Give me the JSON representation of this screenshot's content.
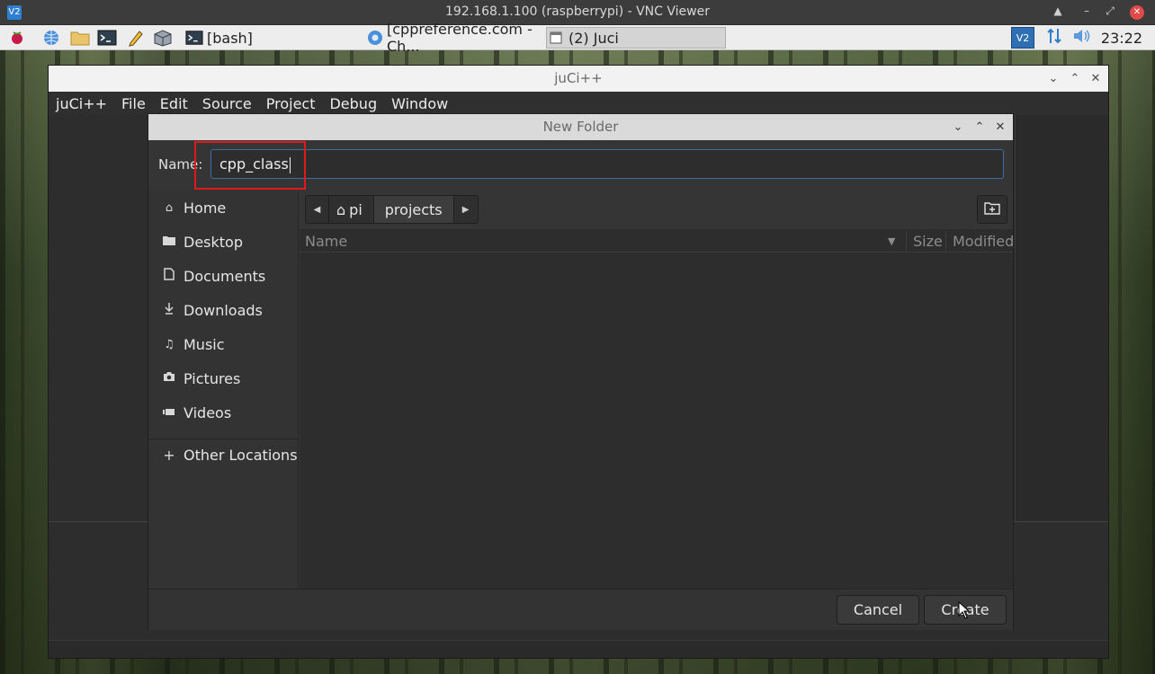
{
  "vnc": {
    "logo": "V2",
    "title": "192.168.1.100 (raspberrypi) - VNC Viewer",
    "controls": [
      "▲",
      "–",
      "⤢"
    ],
    "close": "✕"
  },
  "taskbar": {
    "launchers": [
      "raspberry-icon",
      "web-browser-icon",
      "file-manager-icon",
      "terminal-icon",
      "text-editor-icon",
      "package-icon"
    ],
    "tasks": [
      {
        "label": "[bash]",
        "icon": "terminal-icon"
      },
      {
        "label": "[cppreference.com - Ch...",
        "icon": "chromium-icon"
      },
      {
        "label": "(2) Juci",
        "icon": "window-icon"
      }
    ],
    "tray": [
      "vnc-icon",
      "network-icon",
      "volume-icon"
    ],
    "clock": "23:22"
  },
  "app": {
    "title": "juCi++",
    "menu": [
      "juCi++",
      "File",
      "Edit",
      "Source",
      "Project",
      "Debug",
      "Window"
    ]
  },
  "dialog": {
    "title": "New Folder",
    "name_label": "Name:",
    "name_value": "cpp_class",
    "places": [
      {
        "label": "Home",
        "icon": "home-icon"
      },
      {
        "label": "Desktop",
        "icon": "desktop-folder-icon"
      },
      {
        "label": "Documents",
        "icon": "document-icon"
      },
      {
        "label": "Downloads",
        "icon": "download-icon"
      },
      {
        "label": "Music",
        "icon": "music-icon"
      },
      {
        "label": "Pictures",
        "icon": "camera-icon"
      },
      {
        "label": "Videos",
        "icon": "video-icon"
      },
      {
        "label": "Other Locations",
        "icon": "plus-icon"
      }
    ],
    "path": [
      "pi",
      "projects"
    ],
    "columns": {
      "name": "Name",
      "size": "Size",
      "modified": "Modified"
    },
    "cancel": "Cancel",
    "create": "Create"
  },
  "colors": {
    "highlight": "#e01a1a",
    "focus": "#3b6ea5"
  }
}
